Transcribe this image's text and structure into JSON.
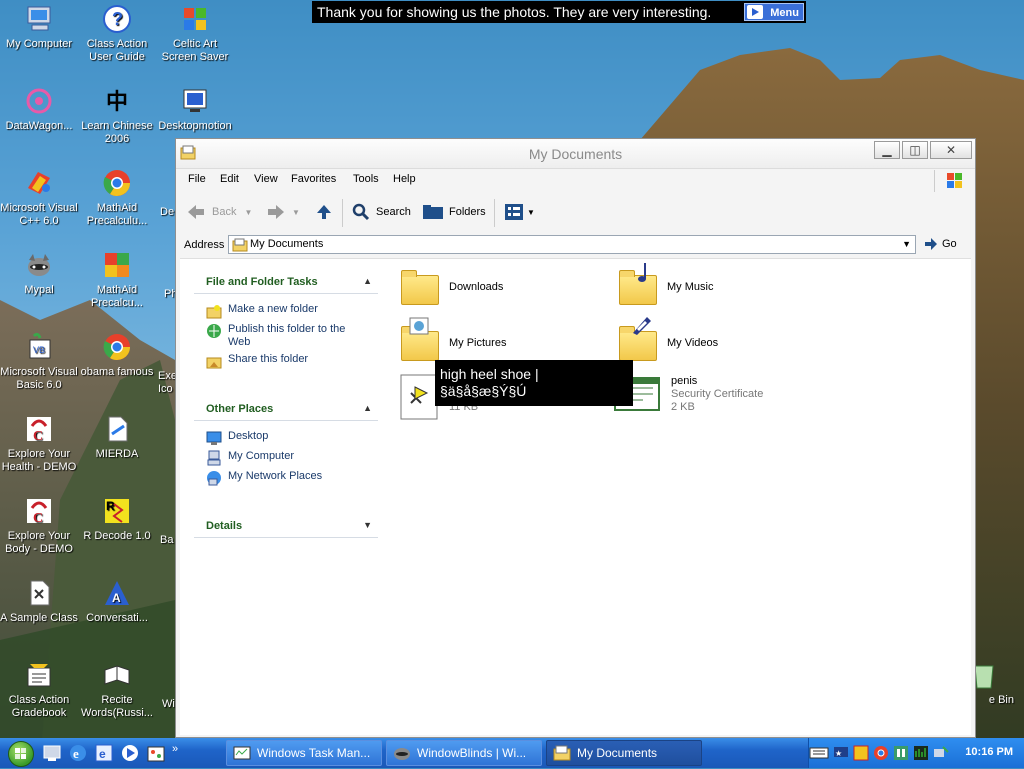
{
  "banner": {
    "text": "Thank you for showing us the photos. They are very interesting.",
    "menu_label": "Menu"
  },
  "desktop_icons": [
    {
      "label": "My Computer",
      "icon": "computer-icon"
    },
    {
      "label": "Class Action User Guide",
      "icon": "help-icon"
    },
    {
      "label": "Celtic Art Screen Saver",
      "icon": "windows-flag-icon"
    },
    {
      "label": "DataWagon...",
      "icon": "datawagon-icon"
    },
    {
      "label": "Learn Chinese 2006",
      "icon": "chinese-char-icon"
    },
    {
      "label": "Desktopmotion",
      "icon": "desktopmotion-icon"
    },
    {
      "label": "Microsoft Visual C++ 6.0",
      "icon": "visual-cpp-icon"
    },
    {
      "label": "MathAid Precalculu...",
      "icon": "chrome-icon"
    },
    {
      "label": "De",
      "icon": "partial-icon"
    },
    {
      "label": "Mypal",
      "icon": "raccoon-icon"
    },
    {
      "label": "MathAid Precalcu...",
      "icon": "mathaid-icon"
    },
    {
      "label": "Ph",
      "icon": "partial-icon"
    },
    {
      "label": "Microsoft Visual Basic 6.0",
      "icon": "visual-basic-icon"
    },
    {
      "label": "obama famous",
      "icon": "chrome-icon"
    },
    {
      "label": "Exe Ico",
      "icon": "partial-icon"
    },
    {
      "label": "Explore Your Health - DEMO",
      "icon": "explore-health-icon"
    },
    {
      "label": "MIERDA",
      "icon": "document-icon"
    },
    {
      "label": "Explore Your Body - DEMO",
      "icon": "explore-body-icon"
    },
    {
      "label": "R Decode 1.0",
      "icon": "rdecode-icon"
    },
    {
      "label": "Ba",
      "icon": "partial-icon"
    },
    {
      "label": "A Sample Class",
      "icon": "sample-class-icon"
    },
    {
      "label": "Conversati...",
      "icon": "conversation-icon"
    },
    {
      "label": "Class Action Gradebook",
      "icon": "gradebook-icon"
    },
    {
      "label": "Recite Words(Russi...",
      "icon": "recite-icon"
    },
    {
      "label": "Wi",
      "icon": "partial-icon"
    },
    {
      "label": "e Bin",
      "icon": "recycle-bin-icon"
    }
  ],
  "window": {
    "title": "My Documents",
    "menu": [
      "File",
      "Edit",
      "View",
      "Favorites",
      "Tools",
      "Help"
    ],
    "toolbar": {
      "back": "Back",
      "search": "Search",
      "folders": "Folders"
    },
    "address": {
      "label": "Address",
      "value": "My Documents",
      "go": "Go"
    },
    "tasks": {
      "file_folder_heading": "File and Folder Tasks",
      "file_folder_links": [
        "Make a new folder",
        "Publish this folder to the Web",
        "Share this folder"
      ],
      "other_places_heading": "Other Places",
      "other_places_links": [
        "Desktop",
        "My Computer",
        "My Network Places"
      ],
      "details_heading": "Details"
    },
    "files": [
      {
        "name": "Downloads",
        "icon": "folder-icon"
      },
      {
        "name": "My Music",
        "icon": "music-folder-icon"
      },
      {
        "name": "My Pictures",
        "icon": "pictures-folder-icon"
      },
      {
        "name": "My Videos",
        "icon": "videos-folder-icon"
      },
      {
        "name": "",
        "type": "",
        "size": "11 KB",
        "icon": "file-icon"
      },
      {
        "name": "penis",
        "type": "Security Certificate",
        "size": "2 KB",
        "icon": "certificate-icon"
      }
    ]
  },
  "tooltip": {
    "line1": "high heel shoe  |",
    "line2": "§ä§å§æ§Ý§Ú"
  },
  "taskbar": {
    "tasks": [
      "Windows Task Man...",
      "WindowBlinds | Wi...",
      "My Documents"
    ],
    "clock": "10:16 PM"
  }
}
